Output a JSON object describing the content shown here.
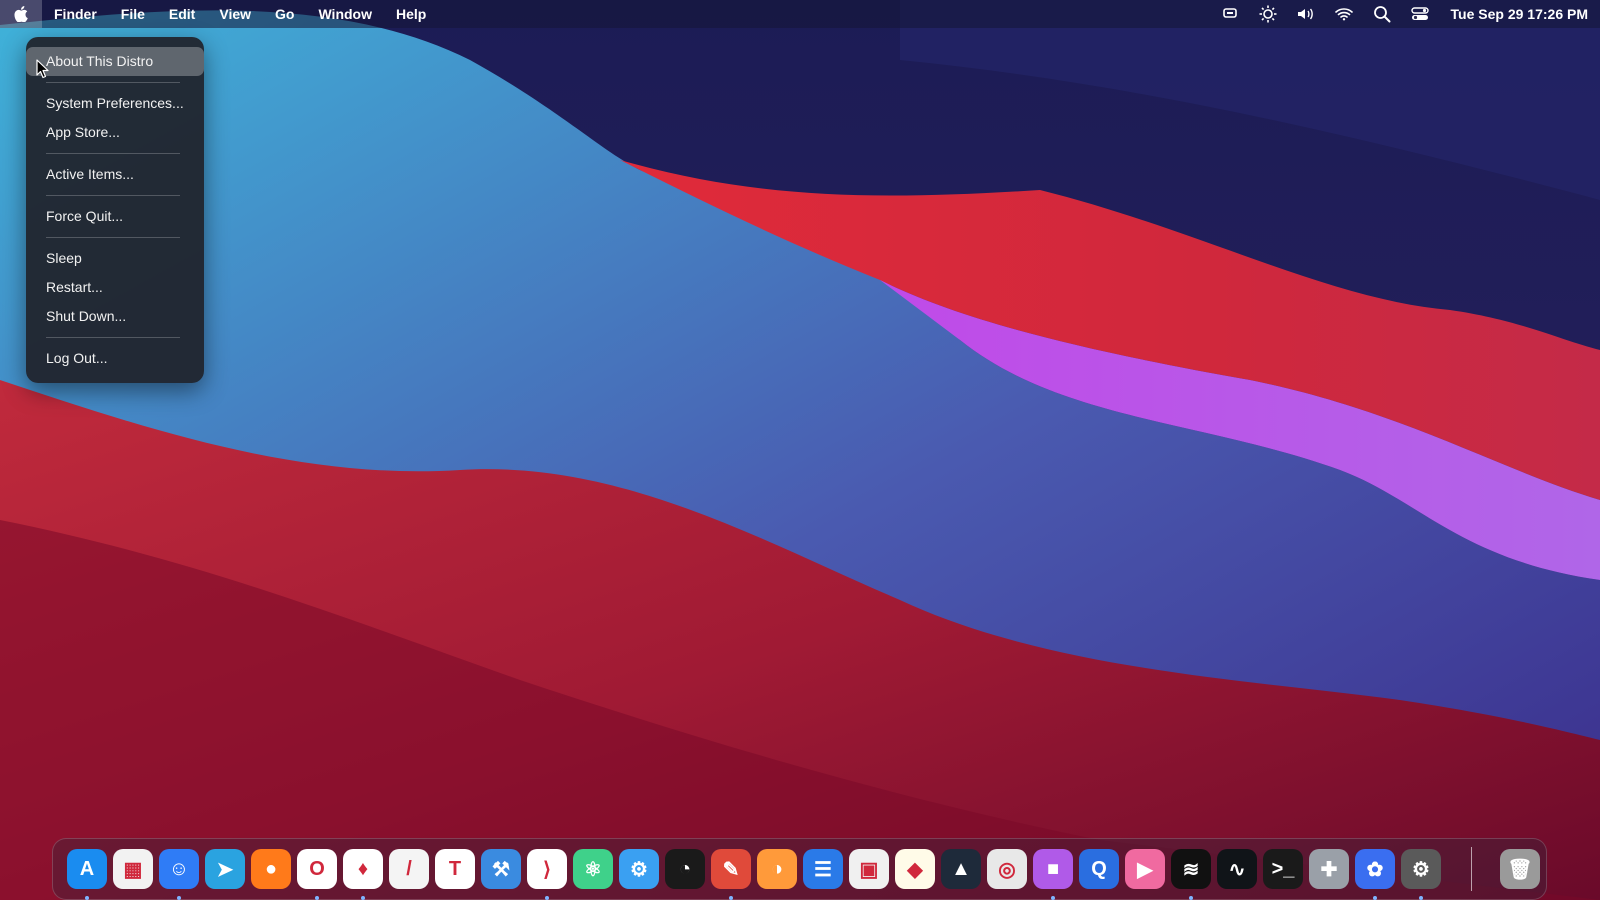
{
  "menubar": {
    "apple_icon": "apple-icon",
    "items": [
      {
        "label": "Finder"
      },
      {
        "label": "File"
      },
      {
        "label": "Edit"
      },
      {
        "label": "View"
      },
      {
        "label": "Go"
      },
      {
        "label": "Window"
      },
      {
        "label": "Help"
      }
    ],
    "tray_icons": [
      "screen-record-icon",
      "brightness-icon",
      "volume-icon",
      "wifi-icon",
      "search-icon",
      "control-center-icon"
    ],
    "clock": "Tue Sep 29  17:26 PM"
  },
  "apple_menu": {
    "items": [
      {
        "label": "About This Distro",
        "active": true
      },
      {
        "separator": true
      },
      {
        "label": "System Preferences..."
      },
      {
        "label": "App Store..."
      },
      {
        "separator": true
      },
      {
        "label": "Active Items..."
      },
      {
        "separator": true
      },
      {
        "label": "Force Quit..."
      },
      {
        "separator": true
      },
      {
        "label": "Sleep"
      },
      {
        "label": "Restart..."
      },
      {
        "label": "Shut Down..."
      },
      {
        "separator": true
      },
      {
        "label": "Log Out..."
      }
    ]
  },
  "dock": {
    "apps": [
      {
        "icon": "app-store-icon",
        "bg": "#1a8cf0",
        "glyph": "A",
        "running": true
      },
      {
        "icon": "launchpad-icon",
        "bg": "#f2f2f2",
        "glyph": "▦",
        "running": false
      },
      {
        "icon": "finder-icon",
        "bg": "#2f7cf6",
        "glyph": "☺",
        "running": true
      },
      {
        "icon": "telegram-icon",
        "bg": "#2aa3e0",
        "glyph": "➤",
        "running": false
      },
      {
        "icon": "firefox-icon",
        "bg": "#ff7a1a",
        "glyph": "●",
        "running": false
      },
      {
        "icon": "opera-icon",
        "bg": "#ffffff",
        "glyph": "O",
        "running": true
      },
      {
        "icon": "brave-icon",
        "bg": "#ffffff",
        "glyph": "♦",
        "running": true
      },
      {
        "icon": "text-editor-icon",
        "bg": "#f4f4f4",
        "glyph": "/",
        "running": false
      },
      {
        "icon": "typora-icon",
        "bg": "#ffffff",
        "glyph": "T",
        "running": false
      },
      {
        "icon": "xcode-icon",
        "bg": "#3a8be0",
        "glyph": "⚒",
        "running": false
      },
      {
        "icon": "vscode-icon",
        "bg": "#ffffff",
        "glyph": "⟩",
        "running": true
      },
      {
        "icon": "atom-icon",
        "bg": "#3fd18a",
        "glyph": "⚛",
        "running": false
      },
      {
        "icon": "settings-gear-icon",
        "bg": "#3aa0f2",
        "glyph": "⚙",
        "running": false
      },
      {
        "icon": "dashboard-icon",
        "bg": "#1a1a1a",
        "glyph": "◔",
        "running": false
      },
      {
        "icon": "safari-compass-icon",
        "bg": "#e04a3a",
        "glyph": "✎",
        "running": true
      },
      {
        "icon": "color-wheel-icon",
        "bg": "#ff9a3a",
        "glyph": "◑",
        "running": false
      },
      {
        "icon": "document-viewer-icon",
        "bg": "#2a7ae8",
        "glyph": "☰",
        "running": false
      },
      {
        "icon": "image-viewer-icon",
        "bg": "#f0f0f0",
        "glyph": "▣",
        "running": false
      },
      {
        "icon": "sketch-icon",
        "bg": "#fffbe8",
        "glyph": "◆",
        "running": false
      },
      {
        "icon": "preview-icon",
        "bg": "#1e2a3a",
        "glyph": "▲",
        "running": false
      },
      {
        "icon": "screenshot-icon",
        "bg": "#e8e8e8",
        "glyph": "◎",
        "running": false
      },
      {
        "icon": "video-recorder-icon",
        "bg": "#b05ae8",
        "glyph": "■",
        "running": true
      },
      {
        "icon": "quicktime-icon",
        "bg": "#2a6ee0",
        "glyph": "Q",
        "running": false
      },
      {
        "icon": "media-player-icon",
        "bg": "#f06aa0",
        "glyph": "▶",
        "running": false
      },
      {
        "icon": "spotify-icon",
        "bg": "#111111",
        "glyph": "≋",
        "running": true
      },
      {
        "icon": "activity-monitor-icon",
        "bg": "#101418",
        "glyph": "∿",
        "running": false
      },
      {
        "icon": "terminal-icon",
        "bg": "#1a1a1a",
        "glyph": ">_",
        "running": false
      },
      {
        "icon": "extensions-icon",
        "bg": "#9aa0a8",
        "glyph": "✚",
        "running": false
      },
      {
        "icon": "gimp-icon",
        "bg": "#3a6ef0",
        "glyph": "✿",
        "running": true
      },
      {
        "icon": "system-preferences-icon",
        "bg": "#5a5a5a",
        "glyph": "⚙",
        "running": true
      }
    ],
    "trash": {
      "icon": "trash-icon",
      "bg": "#9a9a9a",
      "glyph": "🗑"
    }
  },
  "colors": {
    "wallpaper_dark": "#1e1f5a",
    "wallpaper_blue": "#3aa6d4",
    "wallpaper_red": "#d42a3a",
    "wallpaper_violet": "#b04ae8",
    "wallpaper_deep_red": "#7a0a28"
  }
}
